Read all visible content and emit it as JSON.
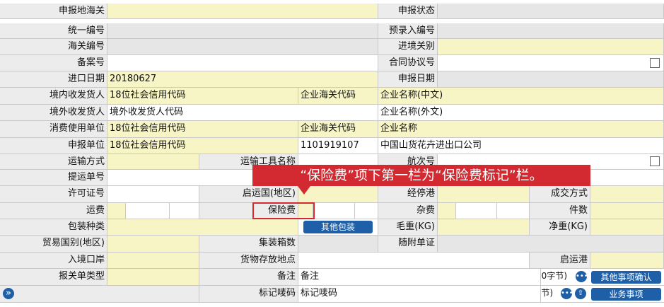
{
  "form": {
    "declare_customs": "申报地海关",
    "declare_status": "申报状态",
    "unified_no": "统一编号",
    "pre_entry_no": "预录入编号",
    "customs_no": "海关编号",
    "entry_exit_customs": "进境关别",
    "record_no": "备案号",
    "contract_no": "合同协议号",
    "import_date_label": "进口日期",
    "import_date_value": "20180627",
    "declare_date": "申报日期",
    "domestic_consignee": "境内收发货人",
    "credit_code_placeholder": "18位社会信用代码",
    "enterprise_customs_code": "企业海关代码",
    "enterprise_name_cn": "企业名称(中文)",
    "foreign_consignee": "境外收发货人",
    "foreign_consignee_code": "境外收发货人代码",
    "enterprise_name_en": "企业名称(外文)",
    "consumer_unit": "消费使用单位",
    "enterprise_name": "企业名称",
    "declare_unit": "申报单位",
    "declare_unit_customs_code": "1101919107",
    "declare_unit_name": "中国山货花卉进出口公司",
    "transport_mode": "运输方式",
    "transport_tool_name": "运输工具名称",
    "voyage_no": "航次号",
    "bill_no": "提运单号",
    "license_no": "许可证号",
    "departure_country": "启运国(地区)",
    "transit_port": "经停港",
    "transaction_mode": "成交方式",
    "freight": "运费",
    "insurance": "保险费",
    "misc_fee": "杂费",
    "pieces": "件数",
    "packaging": "包装种类",
    "other_packaging_btn": "其他包装",
    "gross_weight": "毛重(KG)",
    "net_weight": "净重(KG)",
    "trade_country": "贸易国别(地区)",
    "container_count": "集装箱数",
    "attached_docs": "随附单证",
    "entry_port": "入境口岸",
    "goods_location": "货物存放地点",
    "departure_port": "启运港",
    "declaration_type": "报关单类型",
    "remarks_label": "备注",
    "remarks_value": "备注",
    "bytes_count": "(0字节)",
    "other_confirm_btn": "其他事项确认",
    "marks_label": "标记唛码",
    "marks_value": "标记唛码",
    "business_btn": "业务事项",
    "expand_icon_text": "»",
    "more_icon_text": "•••",
    "up_icon_text": "⇧"
  },
  "annotation": {
    "text": "“保险费”项下第一栏为“保险费标记”栏。"
  },
  "colors": {
    "required": "#f7f5c6",
    "label": "#ececec",
    "readonly": "#e6e6e6",
    "button": "#1f5fa8",
    "callout": "#d22a30"
  }
}
